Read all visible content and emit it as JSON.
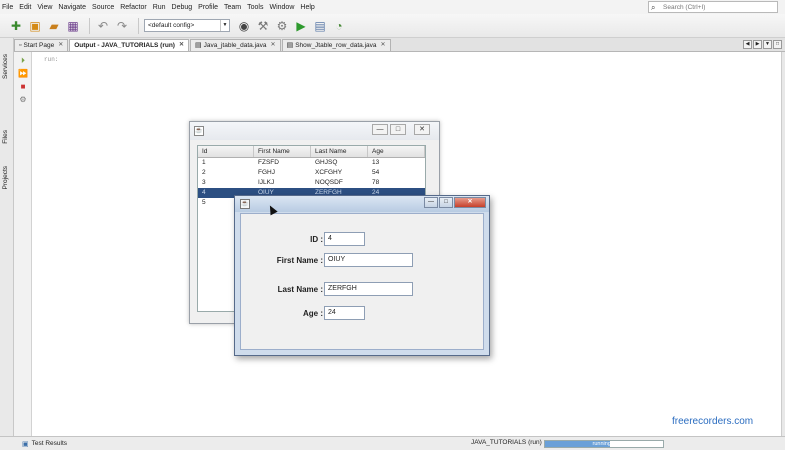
{
  "menu": [
    "File",
    "Edit",
    "View",
    "Navigate",
    "Source",
    "Refactor",
    "Run",
    "Debug",
    "Profile",
    "Team",
    "Tools",
    "Window",
    "Help"
  ],
  "search_placeholder": "Search (Ctrl+I)",
  "toolbar": {
    "config_select": "<default config>"
  },
  "tabs": [
    {
      "label": "Start Page",
      "active": false
    },
    {
      "label": "Output - JAVA_TUTORIALS (run)",
      "active": true
    },
    {
      "label": "Java_jtable_data.java",
      "active": false
    },
    {
      "label": "Show_Jtable_row_data.java",
      "active": false
    }
  ],
  "side_panels": [
    "Services",
    "Files",
    "Projects"
  ],
  "output": {
    "first_line": "run:"
  },
  "status": {
    "test_results": "Test Results",
    "run_label": "JAVA_TUTORIALS (run)",
    "progress_text": "running..."
  },
  "watermark": "freerecorders.com",
  "jtable_window": {
    "columns": [
      "Id",
      "First Name",
      "Last Name",
      "Age"
    ],
    "rows": [
      [
        "1",
        "FZSFD",
        "GHJSQ",
        "13"
      ],
      [
        "2",
        "FGHJ",
        "XCFGHY",
        "54"
      ],
      [
        "3",
        "IJLKJ",
        "NOQSDF",
        "78"
      ],
      [
        "4",
        "OIUY",
        "ZERFGH",
        "24"
      ],
      [
        "5",
        "",
        "",
        ""
      ]
    ],
    "selected_row": 3
  },
  "dialog": {
    "fields": [
      {
        "label": "ID :",
        "value": "4"
      },
      {
        "label": "First Name :",
        "value": "OIUY"
      },
      {
        "label": "Last Name :",
        "value": "ZERFGH"
      },
      {
        "label": "Age :",
        "value": "24"
      }
    ]
  }
}
